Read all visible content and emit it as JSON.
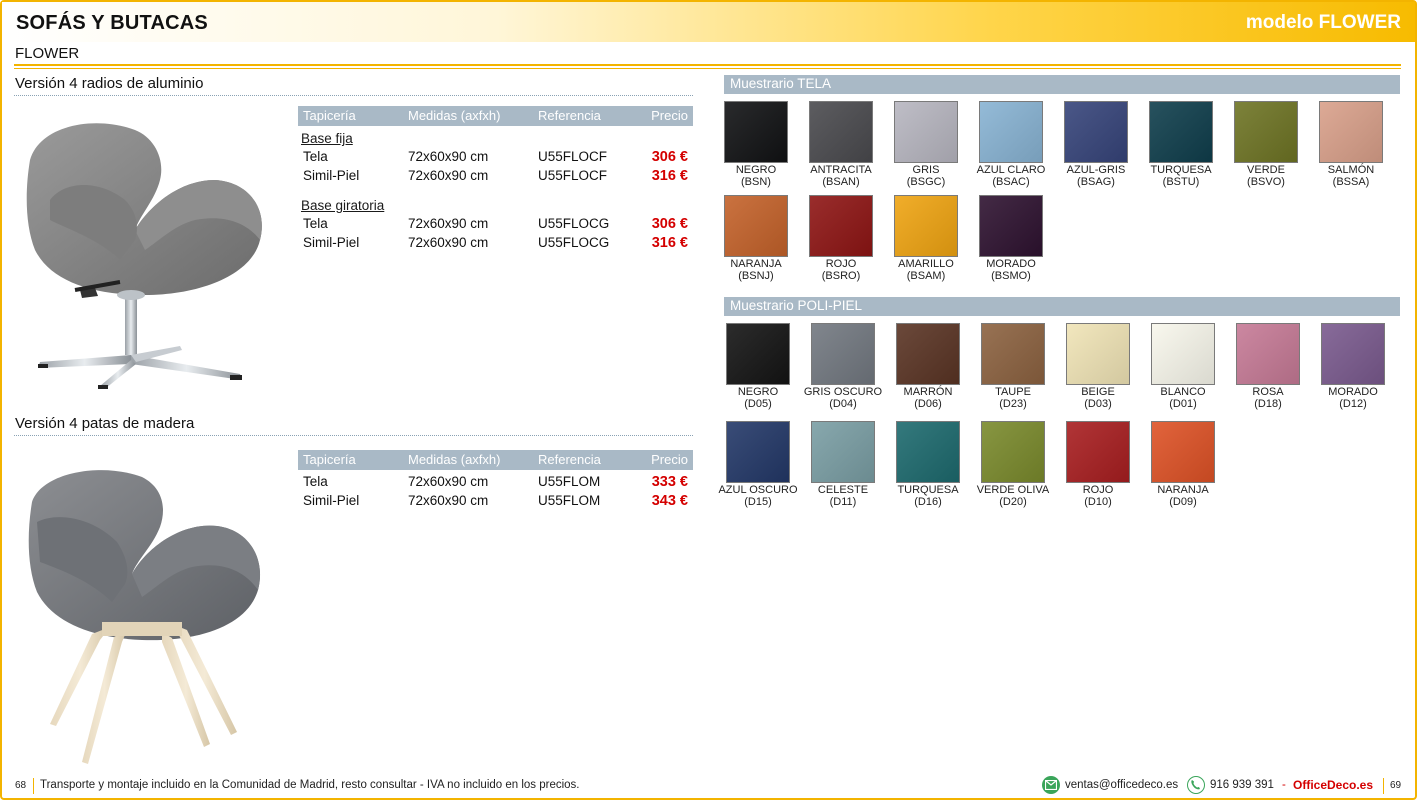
{
  "header": {
    "title": "SOFÁS Y BUTACAS",
    "model": "modelo FLOWER"
  },
  "subtitle": "FLOWER",
  "version1": {
    "title": "Versión 4 radios de aluminio",
    "headers": {
      "tapiceria": "Tapicería",
      "medidas": "Medidas (axfxh)",
      "referencia": "Referencia",
      "precio": "Precio"
    },
    "groups": [
      {
        "title": "Base fija",
        "rows": [
          {
            "tapiceria": "Tela",
            "medidas": "72x60x90 cm",
            "referencia": "U55FLOCF",
            "precio": "306 €"
          },
          {
            "tapiceria": "Simil-Piel",
            "medidas": "72x60x90 cm",
            "referencia": "U55FLOCF",
            "precio": "316 €"
          }
        ]
      },
      {
        "title": "Base giratoria",
        "rows": [
          {
            "tapiceria": "Tela",
            "medidas": "72x60x90 cm",
            "referencia": "U55FLOCG",
            "precio": "306 €"
          },
          {
            "tapiceria": "Simil-Piel",
            "medidas": "72x60x90 cm",
            "referencia": "U55FLOCG",
            "precio": "316 €"
          }
        ]
      }
    ]
  },
  "version2": {
    "title": "Versión 4 patas de madera",
    "headers": {
      "tapiceria": "Tapicería",
      "medidas": "Medidas (axfxh)",
      "referencia": "Referencia",
      "precio": "Precio"
    },
    "rows": [
      {
        "tapiceria": "Tela",
        "medidas": "72x60x90 cm",
        "referencia": "U55FLOM",
        "precio": "333 €"
      },
      {
        "tapiceria": "Simil-Piel",
        "medidas": "72x60x90 cm",
        "referencia": "U55FLOM",
        "precio": "343 €"
      }
    ]
  },
  "muestrario_tela": {
    "title": "Muestrario TELA",
    "swatches": [
      {
        "name": "NEGRO",
        "code": "(BSN)",
        "color": "#111214"
      },
      {
        "name": "ANTRACITA",
        "code": "(BSAN)",
        "color": "#4a4a4e"
      },
      {
        "name": "GRIS",
        "code": "(BSGC)",
        "color": "#b7b6c0"
      },
      {
        "name": "AZUL CLARO",
        "code": "(BSAC)",
        "color": "#88b3d3"
      },
      {
        "name": "AZUL-GRIS",
        "code": "(BSAG)",
        "color": "#36447a"
      },
      {
        "name": "TURQUESA",
        "code": "(BSTU)",
        "color": "#0f3e4c"
      },
      {
        "name": "VERDE",
        "code": "(BSVO)",
        "color": "#6e7424"
      },
      {
        "name": "SALMÓN",
        "code": "(BSSA)",
        "color": "#d9a08a"
      },
      {
        "name": "NARANJA",
        "code": "(BSNJ)",
        "color": "#c4622a"
      },
      {
        "name": "ROJO",
        "code": "(BSRO)",
        "color": "#8e1514"
      },
      {
        "name": "AMARILLO",
        "code": "(BSAM)",
        "color": "#efa412"
      },
      {
        "name": "MORADO",
        "code": "(BSMO)",
        "color": "#2e1230"
      }
    ]
  },
  "muestrario_polipiel": {
    "title": "Muestrario POLI-PIEL",
    "swatches": [
      {
        "name": "NEGRO",
        "code": "(D05)",
        "color": "#141414"
      },
      {
        "name": "GRIS OSCURO",
        "code": "(D04)",
        "color": "#727880"
      },
      {
        "name": "MARRÓN",
        "code": "(D06)",
        "color": "#5a3424"
      },
      {
        "name": "TAUPE",
        "code": "(D23)",
        "color": "#8c6240"
      },
      {
        "name": "BEIGE",
        "code": "(D03)",
        "color": "#f0e4b6"
      },
      {
        "name": "BLANCO",
        "code": "(D01)",
        "color": "#f8f7ec"
      },
      {
        "name": "ROSA",
        "code": "(D18)",
        "color": "#c67a96"
      },
      {
        "name": "MORADO",
        "code": "(D12)",
        "color": "#7a5a8e"
      },
      {
        "name": "AZUL OSCURO",
        "code": "(D15)",
        "color": "#233868"
      },
      {
        "name": "CELESTE",
        "code": "(D11)",
        "color": "#7a9ea4"
      },
      {
        "name": "TURQUESA",
        "code": "(D16)",
        "color": "#1d6a6e"
      },
      {
        "name": "VERDE OLIVA",
        "code": "(D20)",
        "color": "#7a8a2c"
      },
      {
        "name": "ROJO",
        "code": "(D10)",
        "color": "#a81e20"
      },
      {
        "name": "NARANJA",
        "code": "(D09)",
        "color": "#de5226"
      }
    ]
  },
  "footer": {
    "page_left": "68",
    "legal": "Transporte y montaje incluido en la Comunidad de Madrid, resto consultar - IVA no incluido en los precios.",
    "email": "ventas@officedeco.es",
    "phone": "916 939 391",
    "dash": "-",
    "site": "OfficeDeco.es",
    "page_right": "69"
  }
}
